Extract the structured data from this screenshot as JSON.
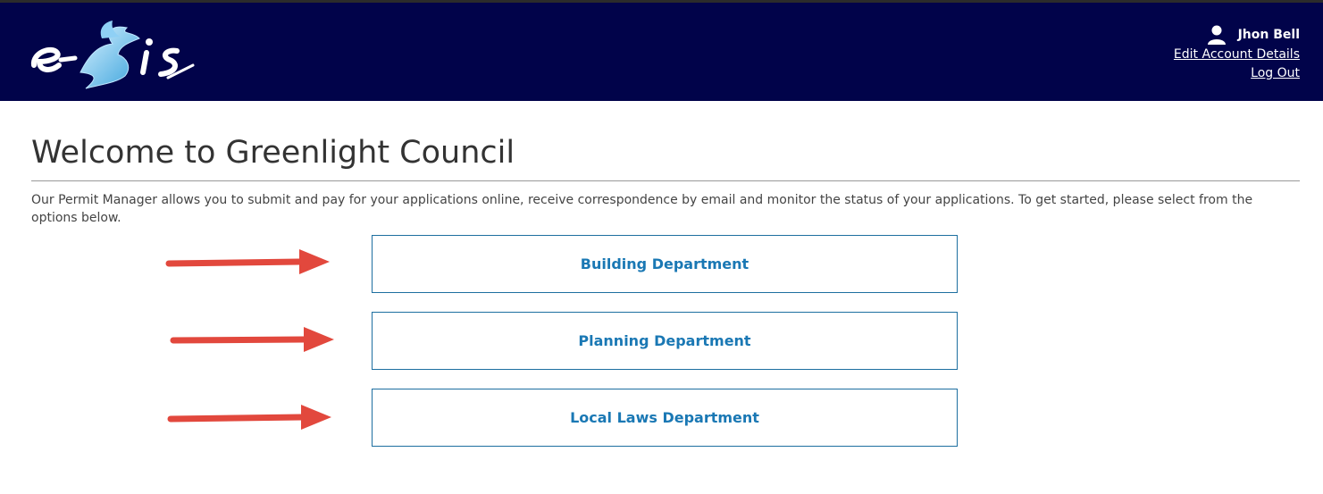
{
  "header": {
    "logo": {
      "icon": "eagle-logo-icon",
      "brand_color": "#01034a"
    },
    "user_name": "Jhon Bell",
    "edit_account_label": "Edit Account Details",
    "logout_label": "Log Out"
  },
  "main": {
    "title": "Welcome to Greenlight Council",
    "intro": "Our Permit Manager allows you to submit and pay for your applications online, receive correspondence by email and monitor the status of your applications. To get started, please select from the options below.",
    "departments": [
      {
        "label": "Building Department"
      },
      {
        "label": "Planning Department"
      },
      {
        "label": "Local Laws Department"
      }
    ]
  },
  "colors": {
    "header_bg": "#01034a",
    "button_text": "#1a78b4",
    "button_border": "#1d6fa0",
    "arrow": "#e2483d"
  }
}
